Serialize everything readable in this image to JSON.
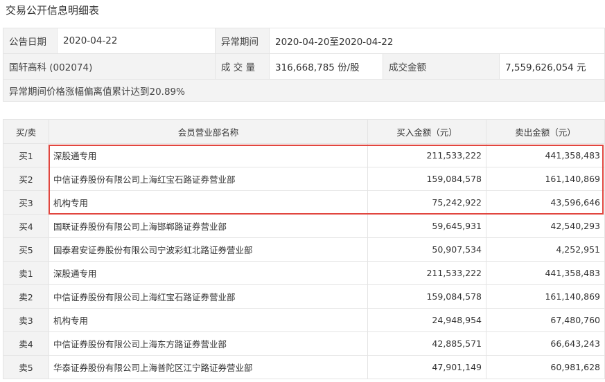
{
  "page_title": "交易公开信息明细表",
  "info": {
    "announce_date_label": "公告日期",
    "announce_date": "2020-04-22",
    "abnormal_period_label": "异常期间",
    "abnormal_period": "2020-04-20至2020-04-22",
    "stock_name": "国轩高科 (002074)",
    "volume_label": "成 交 量",
    "volume": "316,668,785 份/股",
    "amount_label": "成交金额",
    "amount": "7,559,626,054 元",
    "note": "异常期间价格涨幅偏离值累计达到20.89%"
  },
  "table": {
    "headers": [
      "买/卖",
      "会员营业部名称",
      "买入金额（元）",
      "卖出金额（元）"
    ],
    "rows": [
      {
        "side": "买1",
        "name": "深股通专用",
        "buy": "211,533,222",
        "sell": "441,358,483"
      },
      {
        "side": "买2",
        "name": "中信证券股份有限公司上海红宝石路证券营业部",
        "buy": "159,084,578",
        "sell": "161,140,869"
      },
      {
        "side": "买3",
        "name": "机构专用",
        "buy": "75,242,922",
        "sell": "43,596,646"
      },
      {
        "side": "买4",
        "name": "国联证券股份有限公司上海邯郸路证券营业部",
        "buy": "59,645,931",
        "sell": "42,540,293"
      },
      {
        "side": "买5",
        "name": "国泰君安证券股份有限公司宁波彩虹北路证券营业部",
        "buy": "50,907,534",
        "sell": "4,252,951"
      },
      {
        "side": "卖1",
        "name": "深股通专用",
        "buy": "211,533,222",
        "sell": "441,358,483"
      },
      {
        "side": "卖2",
        "name": "中信证券股份有限公司上海红宝石路证券营业部",
        "buy": "159,084,578",
        "sell": "161,140,869"
      },
      {
        "side": "卖3",
        "name": "机构专用",
        "buy": "24,948,954",
        "sell": "67,480,760"
      },
      {
        "side": "卖4",
        "name": "中信证券股份有限公司上海东方路证券营业部",
        "buy": "42,885,571",
        "sell": "66,643,243"
      },
      {
        "side": "卖5",
        "name": "华泰证券股份有限公司上海普陀区江宁路证券营业部",
        "buy": "47,901,149",
        "sell": "60,981,628"
      }
    ]
  },
  "highlight_color": "#e1463f"
}
